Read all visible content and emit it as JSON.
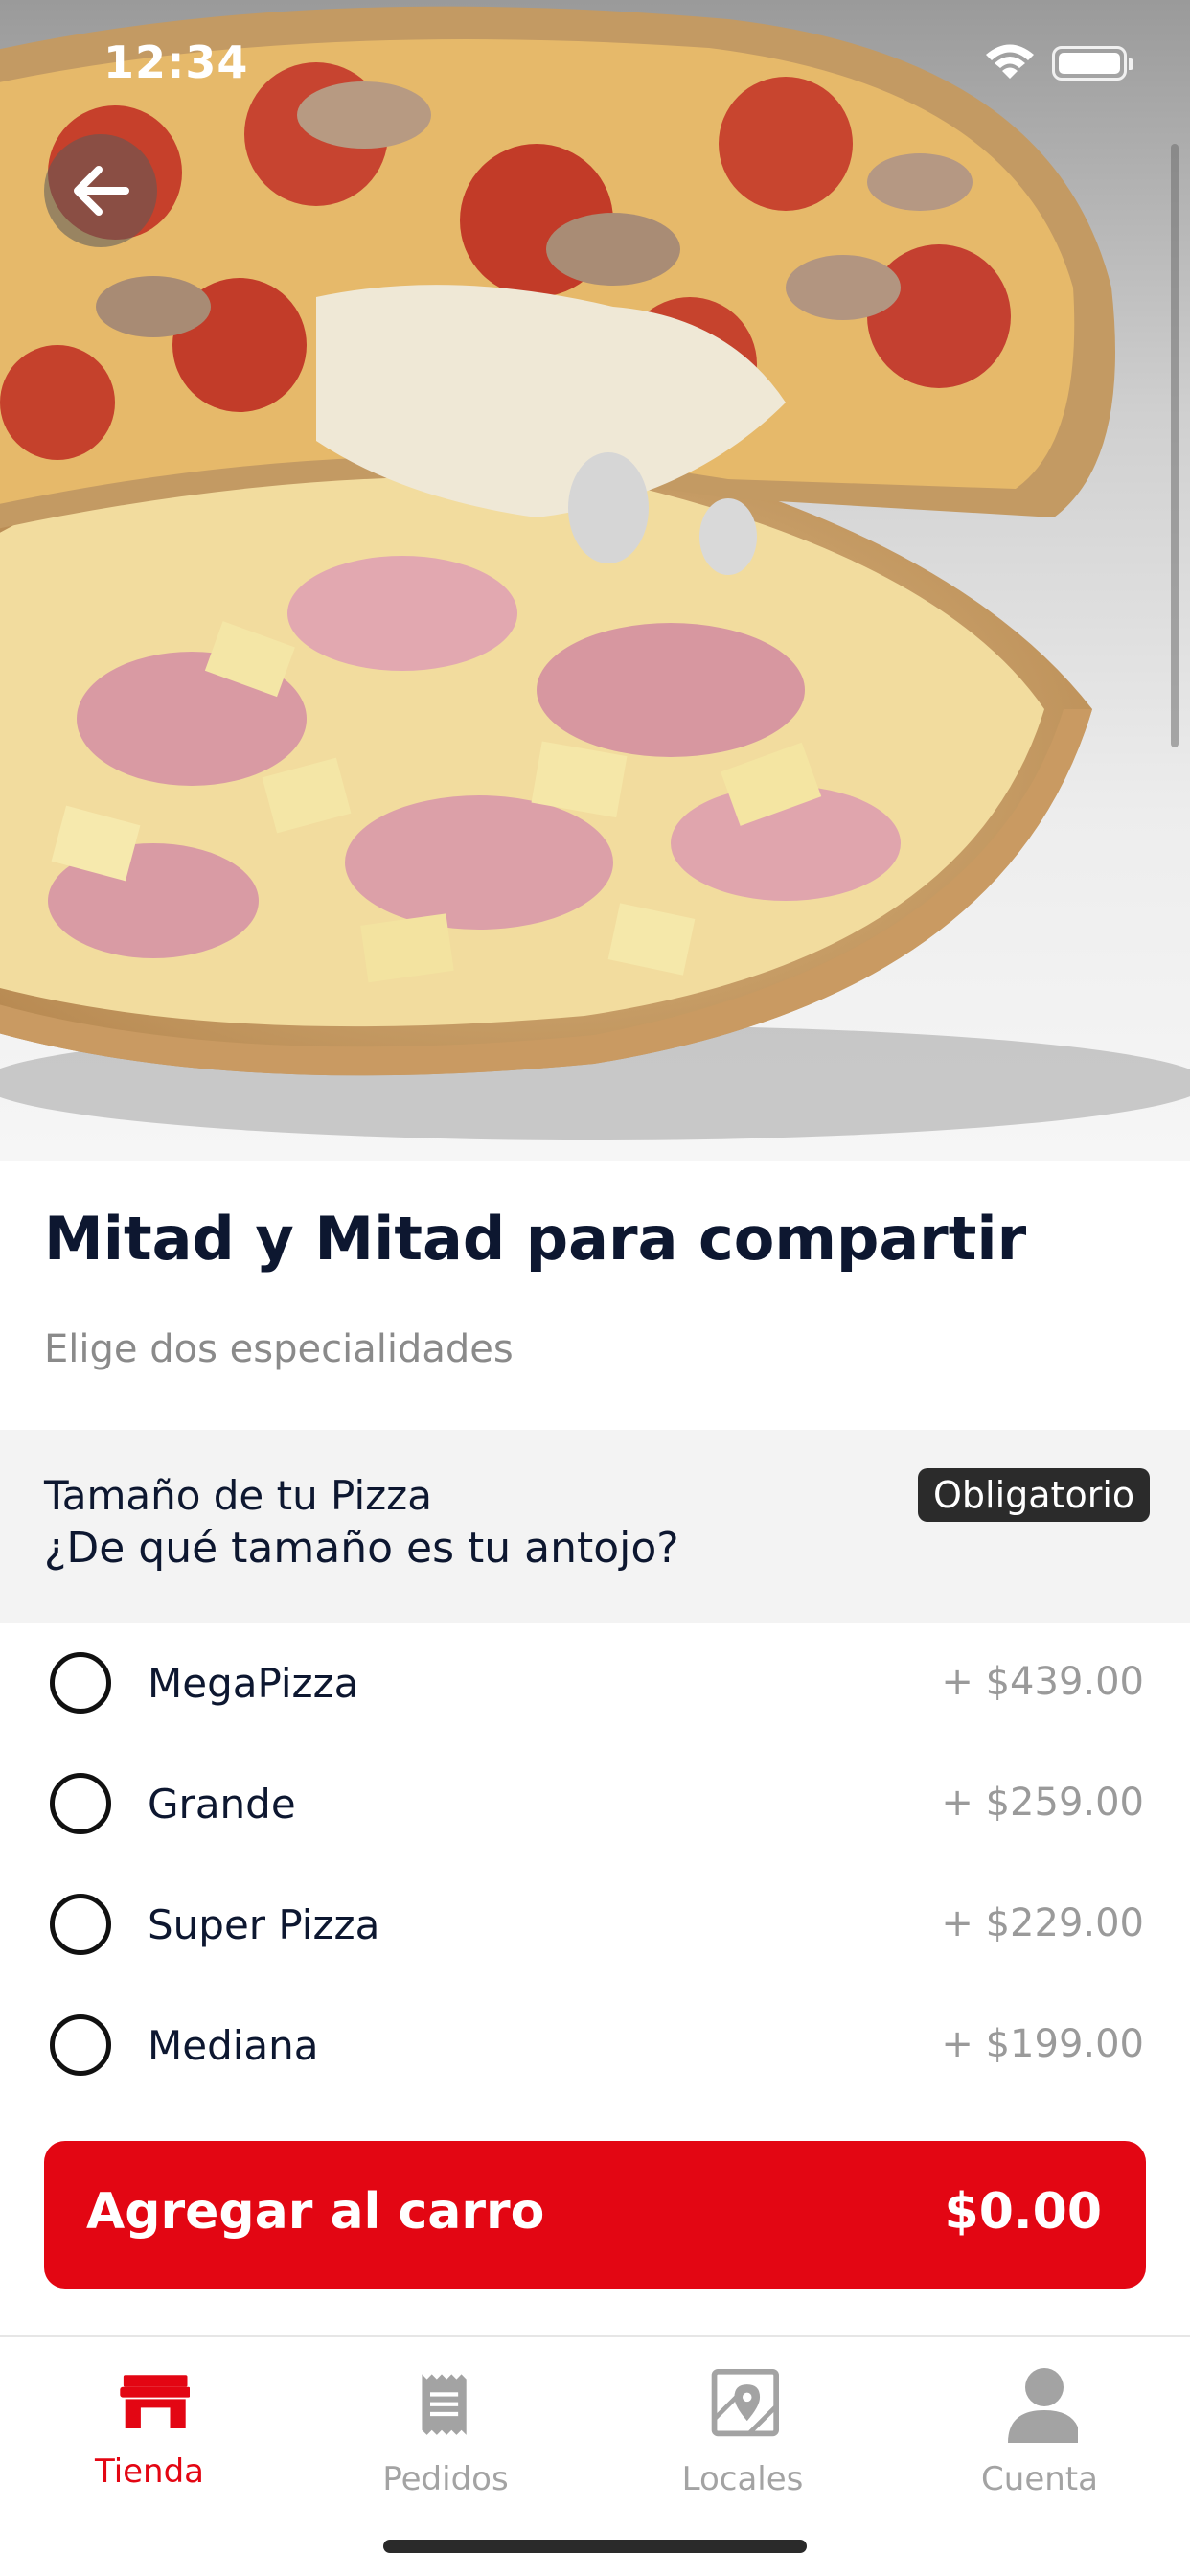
{
  "status_bar": {
    "time": "12:34"
  },
  "product": {
    "title": "Mitad y Mitad para compartir",
    "subtitle": "Elige dos especialidades"
  },
  "size_section": {
    "title": "Tamaño de tu Pizza",
    "question": "¿De qué tamaño es tu antojo?",
    "badge": "Obligatorio",
    "options": [
      {
        "label": "MegaPizza",
        "price": "+ $439.00",
        "selected": false
      },
      {
        "label": "Grande",
        "price": "+ $259.00",
        "selected": false
      },
      {
        "label": "Super Pizza",
        "price": "+ $229.00",
        "selected": false
      },
      {
        "label": "Mediana",
        "price": "+ $199.00",
        "selected": false
      }
    ]
  },
  "cta": {
    "label": "Agregar al carro",
    "price": "$0.00"
  },
  "tabbar": {
    "active": "Tienda",
    "items": [
      {
        "label": "Tienda",
        "icon": "store-icon"
      },
      {
        "label": "Pedidos",
        "icon": "receipt-icon"
      },
      {
        "label": "Locales",
        "icon": "map-icon"
      },
      {
        "label": "Cuenta",
        "icon": "user-icon"
      }
    ]
  },
  "colors": {
    "accent": "#e30613",
    "title": "#0d1730",
    "muted": "#8a8a8a",
    "section_bg": "#f3f3f3"
  }
}
